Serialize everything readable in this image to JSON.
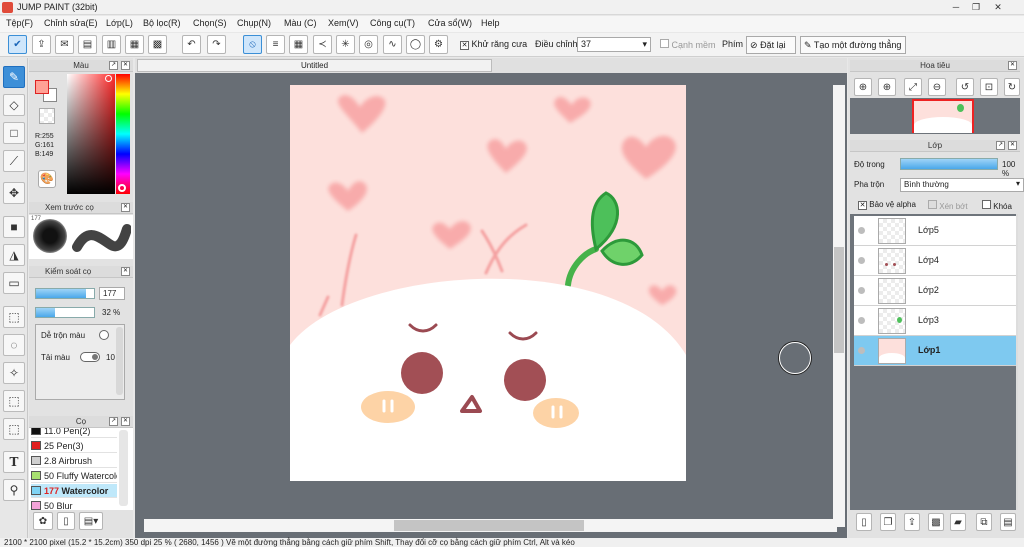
{
  "app": {
    "title": "JUMP PAINT (32bit)"
  },
  "menu": [
    "Tệp(F)",
    "Chỉnh sửa(E)",
    "Lớp(L)",
    "Bộ lọc(R)",
    "Chọn(S)",
    "Chụp(N)",
    "Màu (C)",
    "Xem(V)",
    "Công cụ(T)",
    "Cửa sổ(W)",
    "Help"
  ],
  "toolbar": {
    "antialias_label": "Khử răng cưa",
    "adjust_label": "Điều chỉnh",
    "adjust_value": "37",
    "soft_edge_label": "Cạnh mềm",
    "key_label": "Phím",
    "reset_label": "Đặt lại",
    "straight_line_label": "Tạo một đường thẳng"
  },
  "color_panel": {
    "title": "Màu",
    "r": "R:255",
    "g": "G:161",
    "b": "B:149",
    "fg_color": "#ffa195"
  },
  "preview_panel": {
    "title": "Xem trước cọ",
    "brush_size": "177"
  },
  "brush_control": {
    "title": "Kiểm soát cọ",
    "size_value": "177",
    "opacity_value": "32 %",
    "blend_label": "Dễ trộn màu",
    "ink_label": "Tải màu",
    "ink_value": "10",
    "size_fill": 0.87,
    "opacity_fill": 0.32
  },
  "brush_panel": {
    "title": "Cọ",
    "items": [
      {
        "size": "11.0",
        "name": "Pen(2)",
        "color": "#111111"
      },
      {
        "size": "25",
        "name": "Pen(3)",
        "color": "#e02020"
      },
      {
        "size": "2.8",
        "name": "Airbrush",
        "color": "#cfcfcf"
      },
      {
        "size": "50",
        "name": "Fluffy Watercolor",
        "color": "#a8e070"
      },
      {
        "size": "177",
        "name": "Watercolor",
        "color": "#7fd4f5",
        "selected": true
      },
      {
        "size": "50",
        "name": "Blur",
        "color": "#f3a3d8"
      }
    ]
  },
  "document": {
    "tab_title": "Untitled"
  },
  "navigator": {
    "title": "Hoa tiêu"
  },
  "layers": {
    "title": "Lớp",
    "opacity_label": "Độ trong",
    "opacity_value": "100 %",
    "blend_label": "Pha trộn",
    "blend_value": "Bình thường",
    "protect_alpha_label": "Bảo vệ alpha",
    "clip_label": "Xén bớt",
    "lock_label": "Khóa",
    "items": [
      {
        "name": "Lớp5"
      },
      {
        "name": "Lớp4"
      },
      {
        "name": "Lớp2"
      },
      {
        "name": "Lớp3"
      },
      {
        "name": "Lớp1",
        "selected": true
      }
    ]
  },
  "status": {
    "size": "2100 * 2100 pixel",
    "size_cm": "(15.2 * 15.2cm)",
    "dpi": "350 dpi",
    "zoom": "25 %",
    "coords": "( 2680, 1456 )",
    "hint": "Vẽ một đường thẳng bằng cách giữ phím Shift, Thay đổi cỡ cọ bằng cách giữ phím Ctrl, Alt và kéo"
  }
}
